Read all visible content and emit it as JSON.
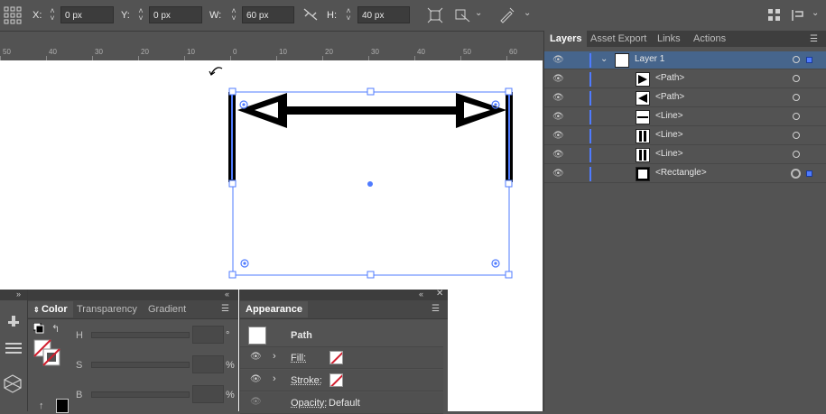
{
  "control_bar": {
    "x_label": "X:",
    "x_value": "0 px",
    "y_label": "Y:",
    "y_value": "0 px",
    "w_label": "W:",
    "w_value": "60 px",
    "h_label": "H:",
    "h_value": "40 px"
  },
  "ruler": {
    "ticks": [
      "50",
      "40",
      "30",
      "20",
      "10",
      "0",
      "10",
      "20",
      "30",
      "40",
      "50",
      "60"
    ]
  },
  "layers_panel": {
    "tabs": [
      "Layers",
      "Asset Export",
      "Links",
      "Actions"
    ],
    "rows": [
      {
        "name": "Layer 1",
        "selected": true
      },
      {
        "name": "<Path>"
      },
      {
        "name": "<Path>"
      },
      {
        "name": "<Line>"
      },
      {
        "name": "<Line>"
      },
      {
        "name": "<Line>"
      },
      {
        "name": "<Rectangle>"
      }
    ]
  },
  "color_panel": {
    "tabs": [
      "Color",
      "Transparency",
      "Gradient"
    ],
    "channels": [
      "H",
      "S",
      "B"
    ],
    "units": [
      "°",
      "%",
      "%"
    ]
  },
  "appearance_panel": {
    "tab": "Appearance",
    "object": "Path",
    "fill_label": "Fill:",
    "stroke_label": "Stroke:",
    "opacity_label": "Opacity:",
    "opacity_value": "Default"
  },
  "colors": {
    "selection": "#4f7bff",
    "panel_bg": "#535353",
    "canvas": "#ffffff"
  }
}
